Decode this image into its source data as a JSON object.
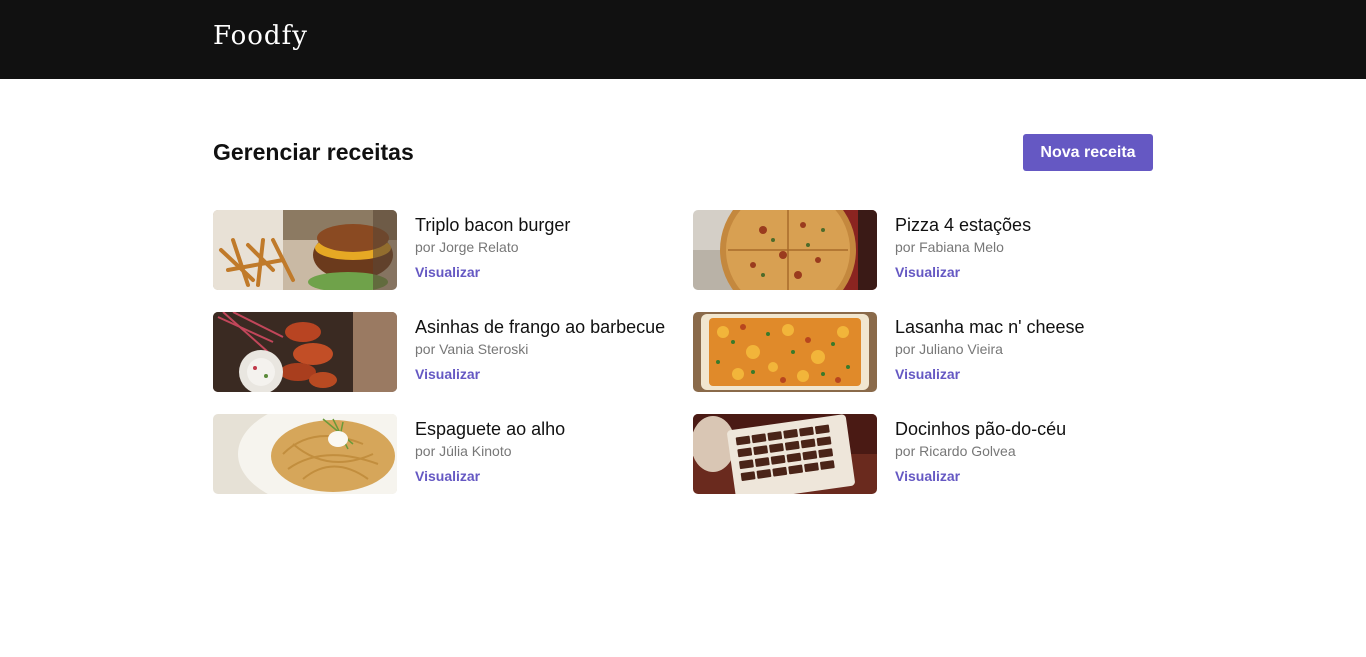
{
  "app": {
    "logo": "Foodfy"
  },
  "header": {
    "title": "Gerenciar receitas",
    "new_button": "Nova receita"
  },
  "recipes": [
    {
      "title": "Triplo bacon burger",
      "author": "por Jorge Relato",
      "link": "Visualizar",
      "image": "burger-image"
    },
    {
      "title": "Pizza 4 estações",
      "author": "por Fabiana Melo",
      "link": "Visualizar",
      "image": "pizza-image"
    },
    {
      "title": "Asinhas de frango ao barbecue",
      "author": "por Vania Steroski",
      "link": "Visualizar",
      "image": "chicken-wings-image"
    },
    {
      "title": "Lasanha mac n' cheese",
      "author": "por Juliano Vieira",
      "link": "Visualizar",
      "image": "lasagna-image"
    },
    {
      "title": "Espaguete ao alho",
      "author": "por Júlia Kinoto",
      "link": "Visualizar",
      "image": "spaghetti-image"
    },
    {
      "title": "Docinhos pão-do-céu",
      "author": "por Ricardo Golvea",
      "link": "Visualizar",
      "image": "chocolates-image"
    }
  ],
  "colors": {
    "accent": "#6558c3",
    "topbar": "#111111",
    "muted_text": "#777777"
  }
}
